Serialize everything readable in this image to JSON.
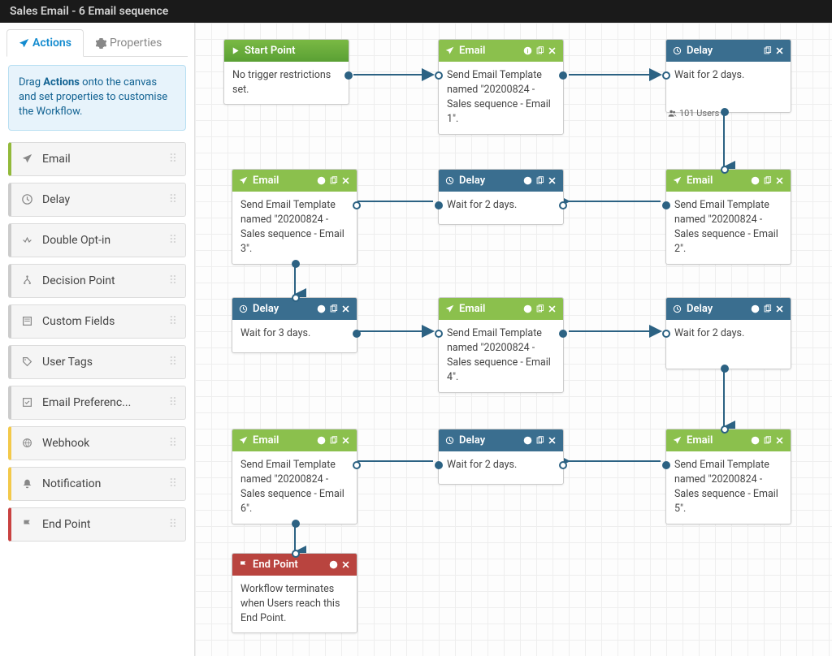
{
  "header": {
    "title": "Sales Email - 6 Email sequence"
  },
  "tabs": {
    "actions": "Actions",
    "properties": "Properties"
  },
  "hint": "Drag Actions onto the canvas and set properties to customise the Workflow.",
  "actions": {
    "email": "Email",
    "delay": "Delay",
    "double_opt_in": "Double Opt-in",
    "decision_point": "Decision Point",
    "custom_fields": "Custom Fields",
    "user_tags": "User Tags",
    "email_preferences": "Email Preferenc...",
    "webhook": "Webhook",
    "notification": "Notification",
    "end_point": "End Point"
  },
  "nodes": {
    "start": {
      "title": "Start Point",
      "body": "No trigger restrictions set."
    },
    "email1": {
      "title": "Email",
      "body": "Send Email Template named \"20200824 - Sales sequence - Email 1\"."
    },
    "delay1": {
      "title": "Delay",
      "body": "Wait for 2 days."
    },
    "email2": {
      "title": "Email",
      "body": "Send Email Template named \"20200824 - Sales sequence - Email 2\"."
    },
    "delay2": {
      "title": "Delay",
      "body": "Wait for 2 days."
    },
    "email3": {
      "title": "Email",
      "body": "Send Email Template named \"20200824 - Sales sequence - Email 3\"."
    },
    "delay3": {
      "title": "Delay",
      "body": "Wait for 3 days."
    },
    "email4": {
      "title": "Email",
      "body": "Send Email Template named \"20200824 - Sales sequence - Email 4\"."
    },
    "delay4": {
      "title": "Delay",
      "body": "Wait for 2 days."
    },
    "email5": {
      "title": "Email",
      "body": "Send Email Template named \"20200824 - Sales sequence - Email 5\"."
    },
    "delay5": {
      "title": "Delay",
      "body": "Wait for 2 days."
    },
    "email6": {
      "title": "Email",
      "body": "Send Email Template named \"20200824 - Sales sequence - Email 6\"."
    },
    "end": {
      "title": "End Point",
      "body": "Workflow terminates when Users reach this End Point."
    }
  },
  "user_badge": "101 Users"
}
